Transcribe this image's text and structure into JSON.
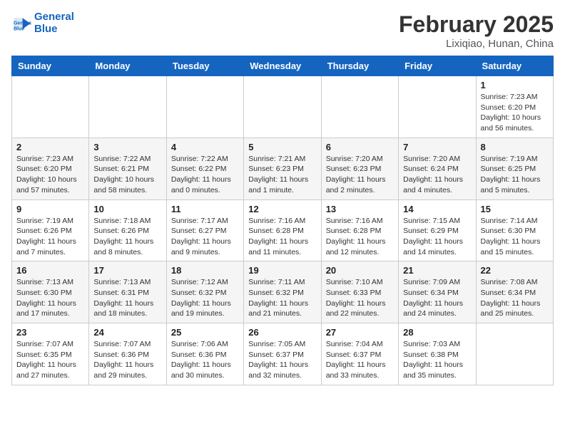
{
  "header": {
    "logo_line1": "General",
    "logo_line2": "Blue",
    "month_year": "February 2025",
    "location": "Lixiqiao, Hunan, China"
  },
  "weekdays": [
    "Sunday",
    "Monday",
    "Tuesday",
    "Wednesday",
    "Thursday",
    "Friday",
    "Saturday"
  ],
  "weeks": [
    [
      {
        "day": "",
        "info": ""
      },
      {
        "day": "",
        "info": ""
      },
      {
        "day": "",
        "info": ""
      },
      {
        "day": "",
        "info": ""
      },
      {
        "day": "",
        "info": ""
      },
      {
        "day": "",
        "info": ""
      },
      {
        "day": "1",
        "info": "Sunrise: 7:23 AM\nSunset: 6:20 PM\nDaylight: 10 hours and 56 minutes."
      }
    ],
    [
      {
        "day": "2",
        "info": "Sunrise: 7:23 AM\nSunset: 6:20 PM\nDaylight: 10 hours and 57 minutes."
      },
      {
        "day": "3",
        "info": "Sunrise: 7:22 AM\nSunset: 6:21 PM\nDaylight: 10 hours and 58 minutes."
      },
      {
        "day": "4",
        "info": "Sunrise: 7:22 AM\nSunset: 6:22 PM\nDaylight: 11 hours and 0 minutes."
      },
      {
        "day": "5",
        "info": "Sunrise: 7:21 AM\nSunset: 6:23 PM\nDaylight: 11 hours and 1 minute."
      },
      {
        "day": "6",
        "info": "Sunrise: 7:20 AM\nSunset: 6:23 PM\nDaylight: 11 hours and 2 minutes."
      },
      {
        "day": "7",
        "info": "Sunrise: 7:20 AM\nSunset: 6:24 PM\nDaylight: 11 hours and 4 minutes."
      },
      {
        "day": "8",
        "info": "Sunrise: 7:19 AM\nSunset: 6:25 PM\nDaylight: 11 hours and 5 minutes."
      }
    ],
    [
      {
        "day": "9",
        "info": "Sunrise: 7:19 AM\nSunset: 6:26 PM\nDaylight: 11 hours and 7 minutes."
      },
      {
        "day": "10",
        "info": "Sunrise: 7:18 AM\nSunset: 6:26 PM\nDaylight: 11 hours and 8 minutes."
      },
      {
        "day": "11",
        "info": "Sunrise: 7:17 AM\nSunset: 6:27 PM\nDaylight: 11 hours and 9 minutes."
      },
      {
        "day": "12",
        "info": "Sunrise: 7:16 AM\nSunset: 6:28 PM\nDaylight: 11 hours and 11 minutes."
      },
      {
        "day": "13",
        "info": "Sunrise: 7:16 AM\nSunset: 6:28 PM\nDaylight: 11 hours and 12 minutes."
      },
      {
        "day": "14",
        "info": "Sunrise: 7:15 AM\nSunset: 6:29 PM\nDaylight: 11 hours and 14 minutes."
      },
      {
        "day": "15",
        "info": "Sunrise: 7:14 AM\nSunset: 6:30 PM\nDaylight: 11 hours and 15 minutes."
      }
    ],
    [
      {
        "day": "16",
        "info": "Sunrise: 7:13 AM\nSunset: 6:30 PM\nDaylight: 11 hours and 17 minutes."
      },
      {
        "day": "17",
        "info": "Sunrise: 7:13 AM\nSunset: 6:31 PM\nDaylight: 11 hours and 18 minutes."
      },
      {
        "day": "18",
        "info": "Sunrise: 7:12 AM\nSunset: 6:32 PM\nDaylight: 11 hours and 19 minutes."
      },
      {
        "day": "19",
        "info": "Sunrise: 7:11 AM\nSunset: 6:32 PM\nDaylight: 11 hours and 21 minutes."
      },
      {
        "day": "20",
        "info": "Sunrise: 7:10 AM\nSunset: 6:33 PM\nDaylight: 11 hours and 22 minutes."
      },
      {
        "day": "21",
        "info": "Sunrise: 7:09 AM\nSunset: 6:34 PM\nDaylight: 11 hours and 24 minutes."
      },
      {
        "day": "22",
        "info": "Sunrise: 7:08 AM\nSunset: 6:34 PM\nDaylight: 11 hours and 25 minutes."
      }
    ],
    [
      {
        "day": "23",
        "info": "Sunrise: 7:07 AM\nSunset: 6:35 PM\nDaylight: 11 hours and 27 minutes."
      },
      {
        "day": "24",
        "info": "Sunrise: 7:07 AM\nSunset: 6:36 PM\nDaylight: 11 hours and 29 minutes."
      },
      {
        "day": "25",
        "info": "Sunrise: 7:06 AM\nSunset: 6:36 PM\nDaylight: 11 hours and 30 minutes."
      },
      {
        "day": "26",
        "info": "Sunrise: 7:05 AM\nSunset: 6:37 PM\nDaylight: 11 hours and 32 minutes."
      },
      {
        "day": "27",
        "info": "Sunrise: 7:04 AM\nSunset: 6:37 PM\nDaylight: 11 hours and 33 minutes."
      },
      {
        "day": "28",
        "info": "Sunrise: 7:03 AM\nSunset: 6:38 PM\nDaylight: 11 hours and 35 minutes."
      },
      {
        "day": "",
        "info": ""
      }
    ]
  ]
}
